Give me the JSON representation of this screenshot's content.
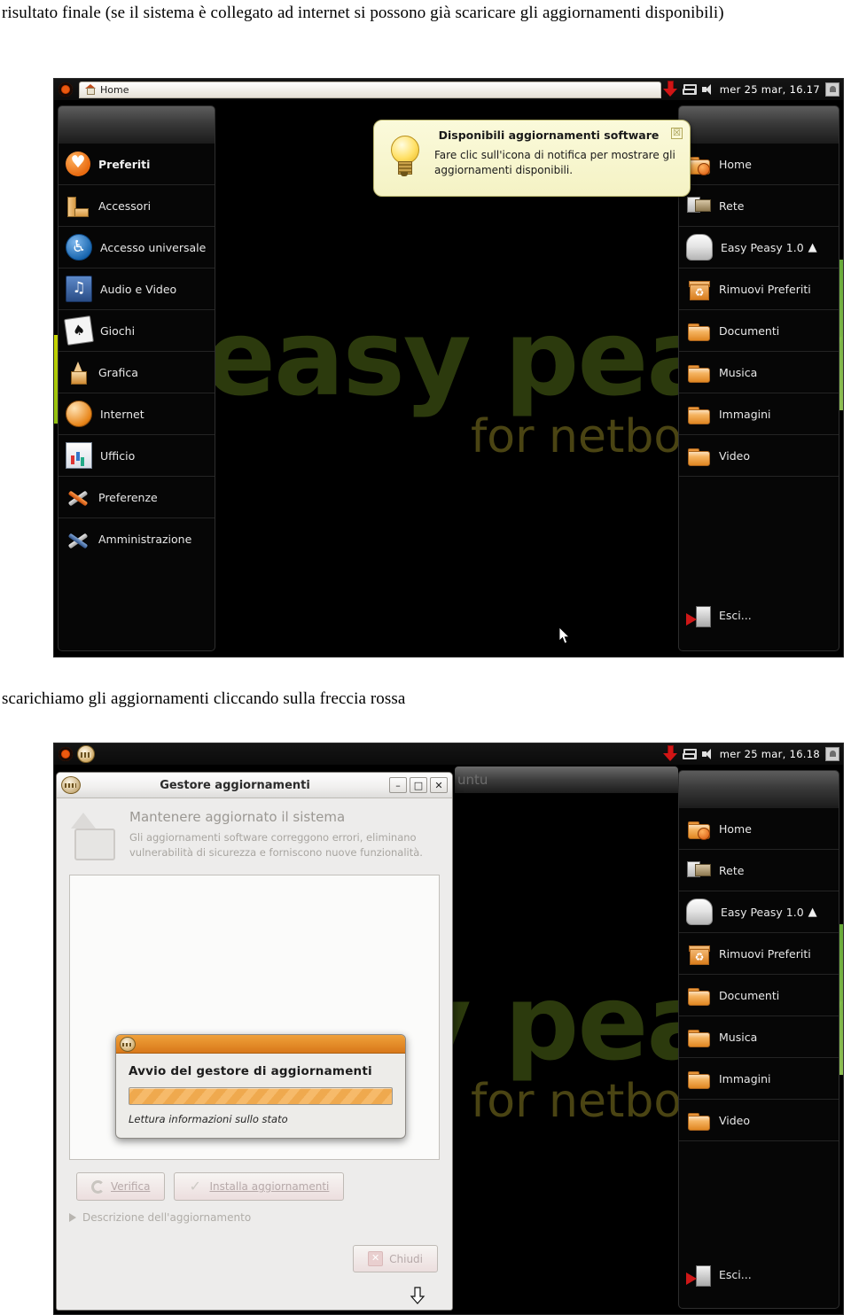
{
  "document": {
    "caption_top": "risultato finale (se il sistema è collegato ad internet si possono già scaricare gli aggiornamenti disponibili)",
    "caption_middle": "scarichiamo gli aggiornamenti cliccando sulla freccia rossa"
  },
  "screenshot1": {
    "panel": {
      "ubuntu_logo": "ubuntu-logo-icon",
      "tab_label": "Home",
      "update_icon": "update-arrow-icon",
      "window_icon": "window-list-icon",
      "volume_icon": "speaker-icon",
      "clock": "mer 25 mar, 16.17",
      "user_icon": "user-switch-icon"
    },
    "notification": {
      "title": "Disponibili aggiornamenti software",
      "body": "Fare clic sull'icona di notifica per mostrare gli aggiornamenti disponibili.",
      "close_label": "☒",
      "icon": "lightbulb-icon"
    },
    "watermark": {
      "main": "easy peasy",
      "sub": "for netbooks"
    },
    "left_menu": [
      {
        "label": "Preferiti",
        "icon": "heart-icon"
      },
      {
        "label": "Accessori",
        "icon": "ruler-icon"
      },
      {
        "label": "Accesso universale",
        "icon": "accessibility-icon"
      },
      {
        "label": "Audio e Video",
        "icon": "music-note-icon"
      },
      {
        "label": "Giochi",
        "icon": "playing-cards-icon"
      },
      {
        "label": "Grafica",
        "icon": "paintbrush-icon"
      },
      {
        "label": "Internet",
        "icon": "globe-icon"
      },
      {
        "label": "Ufficio",
        "icon": "spreadsheet-icon"
      },
      {
        "label": "Preferenze",
        "icon": "wrench-screwdriver-orange-icon"
      },
      {
        "label": "Amministrazione",
        "icon": "wrench-screwdriver-blue-icon"
      }
    ],
    "right_menu": [
      {
        "label": "Home",
        "icon": "home-folder-icon",
        "eject": ""
      },
      {
        "label": "Rete",
        "icon": "network-icon",
        "eject": ""
      },
      {
        "label": "Easy Peasy 1.0",
        "icon": "disk-icon",
        "eject": "▲"
      },
      {
        "label": "Rimuovi Preferiti",
        "icon": "trash-icon",
        "eject": ""
      },
      {
        "label": "Documenti",
        "icon": "folder-icon",
        "eject": ""
      },
      {
        "label": "Musica",
        "icon": "folder-icon",
        "eject": ""
      },
      {
        "label": "Immagini",
        "icon": "folder-icon",
        "eject": ""
      },
      {
        "label": "Video",
        "icon": "folder-icon",
        "eject": ""
      }
    ],
    "logout": {
      "label": "Esci...",
      "icon": "logout-icon"
    }
  },
  "screenshot2": {
    "panel": {
      "ubuntu_logo": "ubuntu-logo-icon",
      "update_manager_icon": "update-manager-icon",
      "update_icon": "update-arrow-icon",
      "window_icon": "window-list-icon",
      "volume_icon": "speaker-icon",
      "clock": "mer 25 mar, 16.18",
      "user_icon": "user-switch-icon"
    },
    "background_title_fragment": "untu",
    "update_manager": {
      "title": "Gestore aggiornamenti",
      "minimize_label": "–",
      "maximize_label": "□",
      "close_label": "✕",
      "heading": "Mantenere aggiornato il sistema",
      "description": "Gli aggiornamenti software correggono errori, eliminano vulnerabilità di sicurezza e forniscono nuove funzionalità.",
      "check_button": "Verifica",
      "install_button": "Installa aggiornamenti",
      "expander": "Descrizione dell'aggiornamento",
      "close_button": "Chiudi"
    },
    "progress_dialog": {
      "heading": "Avvio del gestore di aggiornamenti",
      "status": "Lettura informazioni sullo stato",
      "progress_percent": 100
    },
    "right_menu": [
      {
        "label": "Home",
        "icon": "home-folder-icon",
        "eject": ""
      },
      {
        "label": "Rete",
        "icon": "network-icon",
        "eject": ""
      },
      {
        "label": "Easy Peasy 1.0",
        "icon": "disk-icon",
        "eject": "▲"
      },
      {
        "label": "Rimuovi Preferiti",
        "icon": "trash-icon",
        "eject": ""
      },
      {
        "label": "Documenti",
        "icon": "folder-icon",
        "eject": ""
      },
      {
        "label": "Musica",
        "icon": "folder-icon",
        "eject": ""
      },
      {
        "label": "Immagini",
        "icon": "folder-icon",
        "eject": ""
      },
      {
        "label": "Video",
        "icon": "folder-icon",
        "eject": ""
      }
    ],
    "logout": {
      "label": "Esci...",
      "icon": "logout-icon"
    },
    "watermark": {
      "main": "easy peasy",
      "sub": "for netbooks"
    }
  },
  "colors": {
    "accent_orange": "#e8861a",
    "update_red": "#d11515",
    "notification_bg": "#f4f2c4",
    "watermark_green": "#2c3a0d"
  }
}
